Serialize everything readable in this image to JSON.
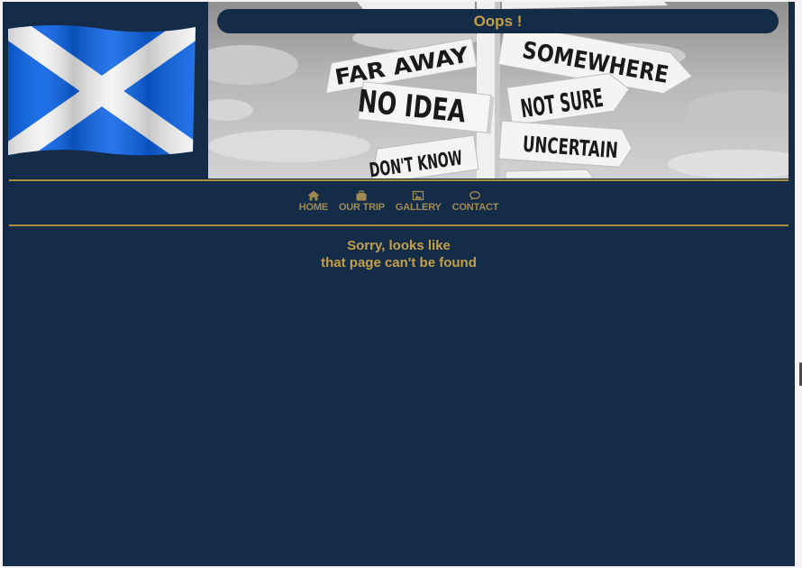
{
  "hero": {
    "title": "Oops !",
    "signs": [
      "FAR AWAY",
      "NO IDEA",
      "DON'T KNOW",
      "SOMEWHERE",
      "NOT SURE",
      "UNCERTAIN"
    ]
  },
  "nav": {
    "items": [
      {
        "label": "HOME",
        "icon": "home-icon"
      },
      {
        "label": "OUR TRIP",
        "icon": "suitcase-icon"
      },
      {
        "label": "GALLERY",
        "icon": "image-icon"
      },
      {
        "label": "CONTACT",
        "icon": "speech-bubble-icon"
      }
    ]
  },
  "message": {
    "line1": "Sorry, looks like",
    "line2": "that page can't be found"
  },
  "colors": {
    "background": "#152c48",
    "accent": "#c2a04a",
    "flag_blue": "#0b63e6"
  }
}
